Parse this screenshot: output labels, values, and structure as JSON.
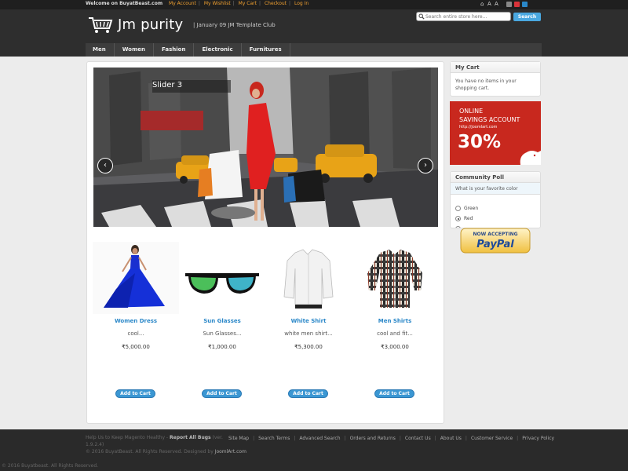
{
  "topbar": {
    "welcome": "Welcome on BuyatBeast.com",
    "links": [
      "My Account",
      "My Wishlist",
      "My Cart",
      "Checkout",
      "Log In"
    ]
  },
  "header": {
    "site_name": "Jm purity",
    "tagline": "| January 09 JM Template Club",
    "search_placeholder": "Search entire store here...",
    "search_button": "Search"
  },
  "nav": [
    "Men",
    "Women",
    "Fashion",
    "Electronic",
    "Furnitures"
  ],
  "slider": {
    "title": "Slider 3",
    "prev_icon": "‹",
    "next_icon": "›"
  },
  "products": [
    {
      "name": "Women Dress",
      "desc": "cool...",
      "price": "₹5,000.00",
      "button": "Add to Cart"
    },
    {
      "name": "Sun Glasses",
      "desc": "Sun Glasses...",
      "price": "₹1,000.00",
      "button": "Add to Cart"
    },
    {
      "name": "White Shirt",
      "desc": "white men shirt...",
      "price": "₹5,300.00",
      "button": "Add to Cart"
    },
    {
      "name": "Men Shirts",
      "desc": "cool and fit...",
      "price": "₹3,000.00",
      "button": "Add to Cart"
    }
  ],
  "cart": {
    "title": "My Cart",
    "empty_text": "You have no items in your shopping cart."
  },
  "savings_ad": {
    "line1": "ONLINE",
    "line2": "SAVINGS ACCOUNT",
    "url": "http://joomlart.com",
    "percent": "30%"
  },
  "poll": {
    "title": "Community Poll",
    "question": "What is your favorite color",
    "options": [
      "Green",
      "Red"
    ],
    "selected": 1
  },
  "paypal": {
    "line1": "NOW ACCEPTING",
    "line2": "PayPal"
  },
  "footer": {
    "help_prefix": "Help Us to Keep Magento Healthy - ",
    "help_link": "Report All Bugs",
    "help_version": "(ver.",
    "version": "1.9.2.4)",
    "copyright": "© 2016 BuyatBeast. All Rights Reserved. Designed by ",
    "designer": "JoomlArt.com",
    "links": [
      "Site Map",
      "Search Terms",
      "Advanced Search",
      "Orders and Returns",
      "Contact Us",
      "About Us",
      "Customer Service",
      "Privacy Policy"
    ],
    "bottom": "© 2016 Buyatbeast. All Rights Reserved."
  },
  "colors": {
    "accent": "#3b97d3",
    "link_orange": "#f0a030",
    "ad_red": "#c8281e"
  }
}
